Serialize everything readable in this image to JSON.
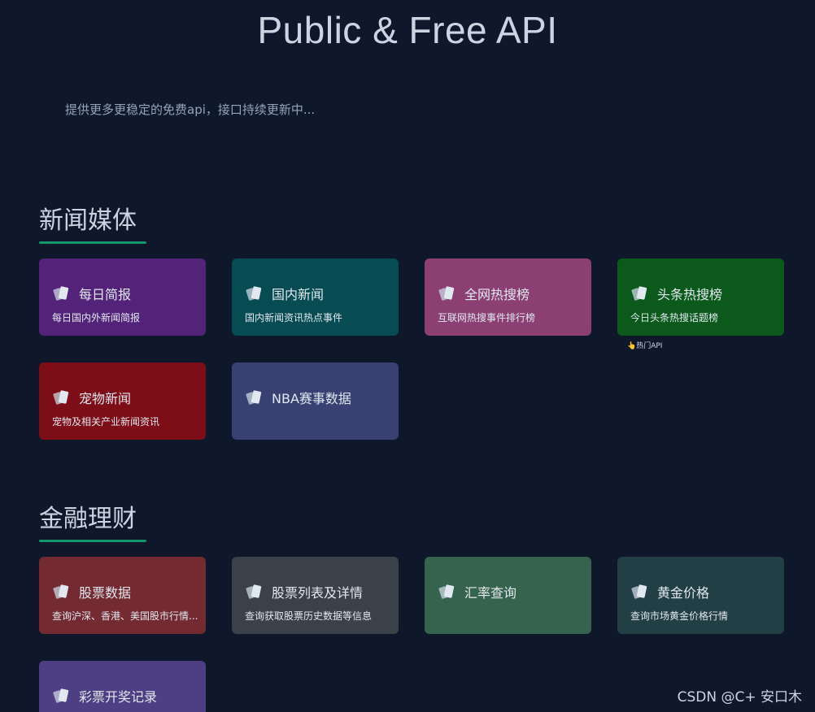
{
  "header": {
    "title": "Public & Free API",
    "subtitle": "提供更多更稳定的免费api，接口持续更新中..."
  },
  "sections": [
    {
      "title": "新闻媒体",
      "cards": [
        {
          "name": "每日简报",
          "desc": "每日国内外新闻简报",
          "color": "#53237a"
        },
        {
          "name": "国内新闻",
          "desc": "国内新闻资讯热点事件",
          "color": "#064c52"
        },
        {
          "name": "全网热搜榜",
          "desc": "互联网热搜事件排行榜",
          "color": "#8b3f73"
        },
        {
          "name": "头条热搜榜",
          "desc": "今日头条热搜话题榜",
          "color": "#0b5a1c",
          "badge": "👆热门API"
        },
        {
          "name": "宠物新闻",
          "desc": "宠物及相关产业新闻资讯",
          "color": "#7d0d17"
        },
        {
          "name": "NBA赛事数据",
          "desc": "",
          "color": "#384172"
        }
      ]
    },
    {
      "title": "金融理财",
      "cards": [
        {
          "name": "股票数据",
          "desc": "查询沪深、香港、美国股市行情...",
          "color": "#732a31"
        },
        {
          "name": "股票列表及详情",
          "desc": "查询获取股票历史数据等信息",
          "color": "#3a4148"
        },
        {
          "name": "汇率查询",
          "desc": "",
          "color": "#36634d"
        },
        {
          "name": "黄金价格",
          "desc": "查询市场黄金价格行情",
          "color": "#213f44"
        },
        {
          "name": "彩票开奖记录",
          "desc": "",
          "color": "#4e3e82"
        }
      ]
    }
  ],
  "watermark": "CSDN @C+   安口木",
  "icon": "cards-icon"
}
